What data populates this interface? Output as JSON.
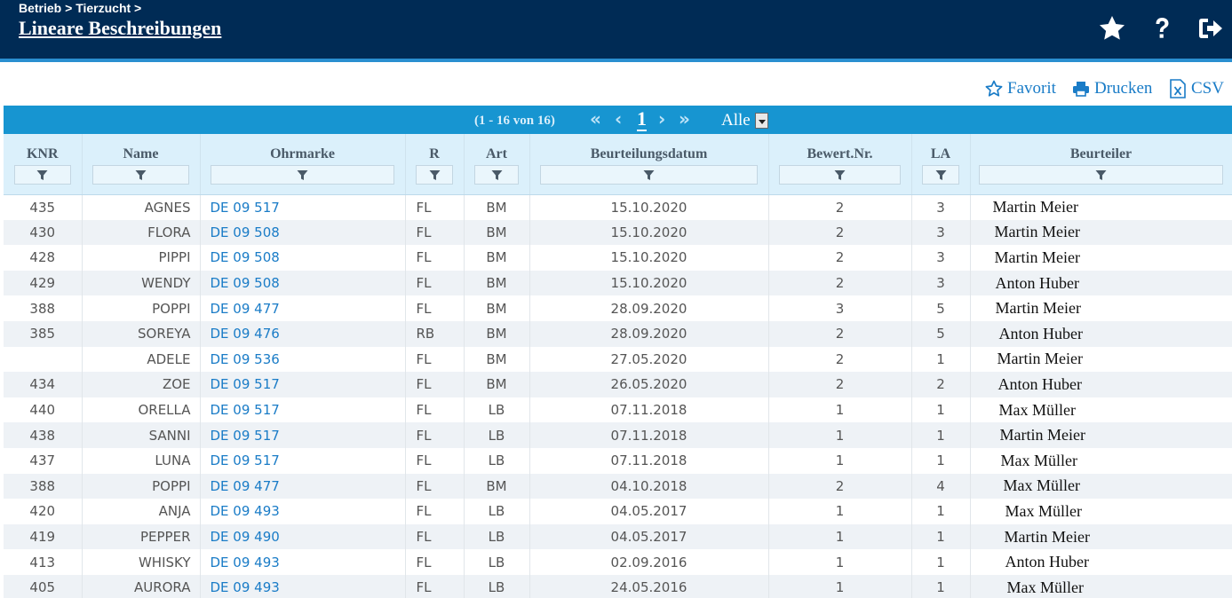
{
  "header": {
    "breadcrumb": "Betrieb > Tierzucht >",
    "title": "Lineare Beschreibungen",
    "icons": [
      "star-icon",
      "help-icon",
      "logout-icon"
    ]
  },
  "actions": {
    "favorit": "Favorit",
    "drucken": "Drucken",
    "csv": "CSV"
  },
  "pager": {
    "range": "(1 - 16 von 16)",
    "current_page": "1",
    "page_size": "Alle"
  },
  "columns": [
    "KNR",
    "Name",
    "Ohrmarke",
    "R",
    "Art",
    "Beurteilungsdatum",
    "Bewert.Nr.",
    "LA",
    "Beurteiler"
  ],
  "rows": [
    [
      "435",
      "AGNES",
      "DE 09 517",
      "FL",
      "BM",
      "15.10.2020",
      "2",
      "3",
      "Martin Meier"
    ],
    [
      "430",
      "FLORA",
      "DE 09 508",
      "FL",
      "BM",
      "15.10.2020",
      "2",
      "3",
      "Martin Meier"
    ],
    [
      "428",
      "PIPPI",
      "DE 09 508",
      "FL",
      "BM",
      "15.10.2020",
      "2",
      "3",
      "Martin Meier"
    ],
    [
      "429",
      "WENDY",
      "DE 09 508",
      "FL",
      "BM",
      "15.10.2020",
      "2",
      "3",
      "Anton Huber"
    ],
    [
      "388",
      "POPPI",
      "DE 09 477",
      "FL",
      "BM",
      "28.09.2020",
      "3",
      "5",
      "Martin Meier"
    ],
    [
      "385",
      "SOREYA",
      "DE 09 476",
      "RB",
      "BM",
      "28.09.2020",
      "2",
      "5",
      "Anton Huber"
    ],
    [
      "",
      "ADELE",
      "DE 09 536",
      "FL",
      "BM",
      "27.05.2020",
      "2",
      "1",
      "Martin Meier"
    ],
    [
      "434",
      "ZOE",
      "DE 09 517",
      "FL",
      "BM",
      "26.05.2020",
      "2",
      "2",
      "Anton Huber"
    ],
    [
      "440",
      "ORELLA",
      "DE 09 517",
      "FL",
      "LB",
      "07.11.2018",
      "1",
      "1",
      "Max Müller"
    ],
    [
      "438",
      "SANNI",
      "DE 09 517",
      "FL",
      "LB",
      "07.11.2018",
      "1",
      "1",
      "Martin Meier"
    ],
    [
      "437",
      "LUNA",
      "DE 09 517",
      "FL",
      "LB",
      "07.11.2018",
      "1",
      "1",
      "Max Müller"
    ],
    [
      "388",
      "POPPI",
      "DE 09 477",
      "FL",
      "BM",
      "04.10.2018",
      "2",
      "4",
      "Max Müller"
    ],
    [
      "420",
      "ANJA",
      "DE 09 493",
      "FL",
      "LB",
      "04.05.2017",
      "1",
      "1",
      "Max Müller"
    ],
    [
      "419",
      "PEPPER",
      "DE 09 490",
      "FL",
      "LB",
      "04.05.2017",
      "1",
      "1",
      "Martin Meier"
    ],
    [
      "413",
      "WHISKY",
      "DE 09 493",
      "FL",
      "LB",
      "02.09.2016",
      "1",
      "1",
      "Anton Huber"
    ],
    [
      "405",
      "AURORA",
      "DE 09 493",
      "FL",
      "LB",
      "24.05.2016",
      "1",
      "1",
      "Max Müller"
    ]
  ]
}
